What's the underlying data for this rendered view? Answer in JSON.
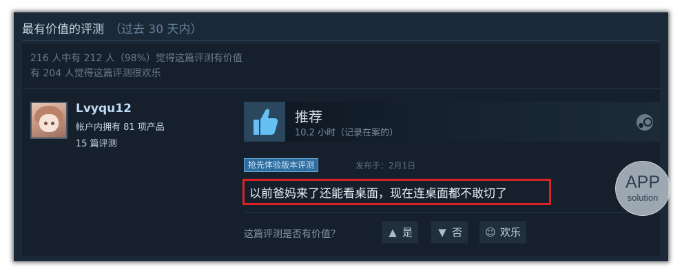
{
  "section": {
    "title": "最有价值的评测",
    "period": "（过去 30 天内）"
  },
  "stats": {
    "helpful_line": "216 人中有 212 人（98%）觉得这篇评测有价值",
    "funny_line": "有 204 人觉得这篇评测很欢乐"
  },
  "author": {
    "name": "Lvyqu12",
    "products": "帐户内拥有 81 项产品",
    "reviews": "15 篇评测"
  },
  "recommendation": {
    "label": "推荐",
    "hours": "10.2 小时（记录在案的）",
    "thumb_icon": "thumbs-up-icon",
    "platform_icon": "steam-icon"
  },
  "review": {
    "badge": "抢先体验版本评测",
    "posted": "发布于：2月1日",
    "text": "以前爸妈来了还能看桌面，现在连桌面都不敢切了"
  },
  "controls": {
    "question": "这篇评测是否有价值？",
    "yes": "是",
    "no": "否",
    "funny": "欢乐"
  },
  "watermark": {
    "big": "APP",
    "small": "solution"
  },
  "colors": {
    "background": "#1b2838",
    "accent_blue": "#2a475e",
    "highlight_red": "#d92328",
    "username": "#c1dbf4"
  }
}
